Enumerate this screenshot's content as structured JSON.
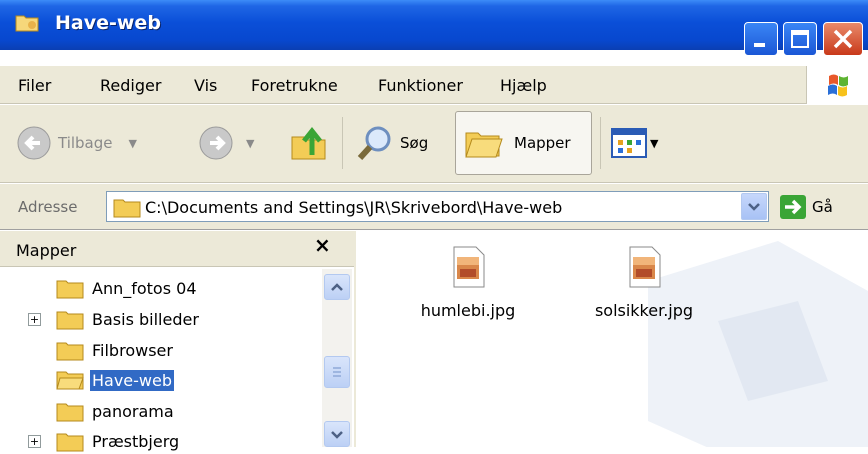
{
  "window": {
    "title": "Have-web"
  },
  "menu": [
    "Filer",
    "Rediger",
    "Vis",
    "Foretrukne",
    "Funktioner",
    "Hjælp"
  ],
  "toolbar": {
    "back_label": "Tilbage",
    "search_label": "Søg",
    "folders_label": "Mapper"
  },
  "address": {
    "label": "Adresse",
    "value": "C:\\Documents and Settings\\JR\\Skrivebord\\Have-web",
    "go_label": "Gå"
  },
  "folders_pane": {
    "title": "Mapper",
    "close": "×",
    "items": [
      {
        "label": "Ann_fotos 04",
        "expandable": false,
        "selected": false
      },
      {
        "label": "Basis billeder",
        "expandable": true,
        "selected": false
      },
      {
        "label": "Filbrowser",
        "expandable": false,
        "selected": false
      },
      {
        "label": "Have-web",
        "expandable": false,
        "selected": true
      },
      {
        "label": "panorama",
        "expandable": false,
        "selected": false
      },
      {
        "label": "Præstbjerg",
        "expandable": true,
        "selected": false
      }
    ]
  },
  "files": [
    {
      "name": "humlebi.jpg",
      "icon": "jpeg-image-icon"
    },
    {
      "name": "solsikker.jpg",
      "icon": "jpeg-image-icon"
    }
  ],
  "colors": {
    "titlebar": "#0a4fd8",
    "selection": "#316ac5",
    "chrome": "#ece9d8"
  }
}
